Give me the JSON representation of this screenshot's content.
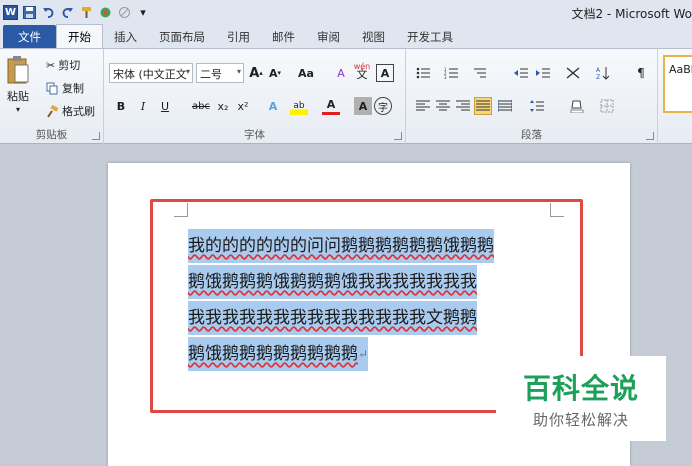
{
  "window": {
    "title": "文档2 - Microsoft Wo"
  },
  "qat": {
    "logo": "W",
    "menu_glyph": "▾"
  },
  "tabs": [
    "文件",
    "开始",
    "插入",
    "页面布局",
    "引用",
    "邮件",
    "审阅",
    "视图",
    "开发工具"
  ],
  "ribbon": {
    "clipboard": {
      "label": "剪贴板",
      "paste": "粘贴",
      "cut": "剪切",
      "copy": "复制",
      "format_painter": "格式刷"
    },
    "font": {
      "label": "字体",
      "font_name": "宋体 (中文正文",
      "font_size": "二号",
      "grow": "A",
      "shrink": "A",
      "change_case": "Aa",
      "clear": "A",
      "phonetic": "wén",
      "border": "A",
      "bold": "B",
      "italic": "I",
      "underline": "U",
      "strike": "abc",
      "sub": "x₂",
      "sup": "x²",
      "effects": "A",
      "highlight": "ab",
      "color": "A",
      "shade": "A",
      "enclose": "字"
    },
    "paragraph": {
      "label": "段落"
    },
    "styles": {
      "sample": "AaBbC"
    }
  },
  "document": {
    "lines": [
      "我的的的的的的问问鹅鹅鹅鹅鹅鹅饿鹅鹅",
      "鹅饿鹅鹅鹅饿鹅鹅鹅饿我我我我我我我",
      "我我我我我我我我我我我我我我文鹅鹅",
      "鹅饿鹅鹅鹅鹅鹅鹅鹅鹅"
    ],
    "para_mark": "↵"
  },
  "watermark": {
    "title": "百科全说",
    "subtitle": "助你轻松解决"
  }
}
